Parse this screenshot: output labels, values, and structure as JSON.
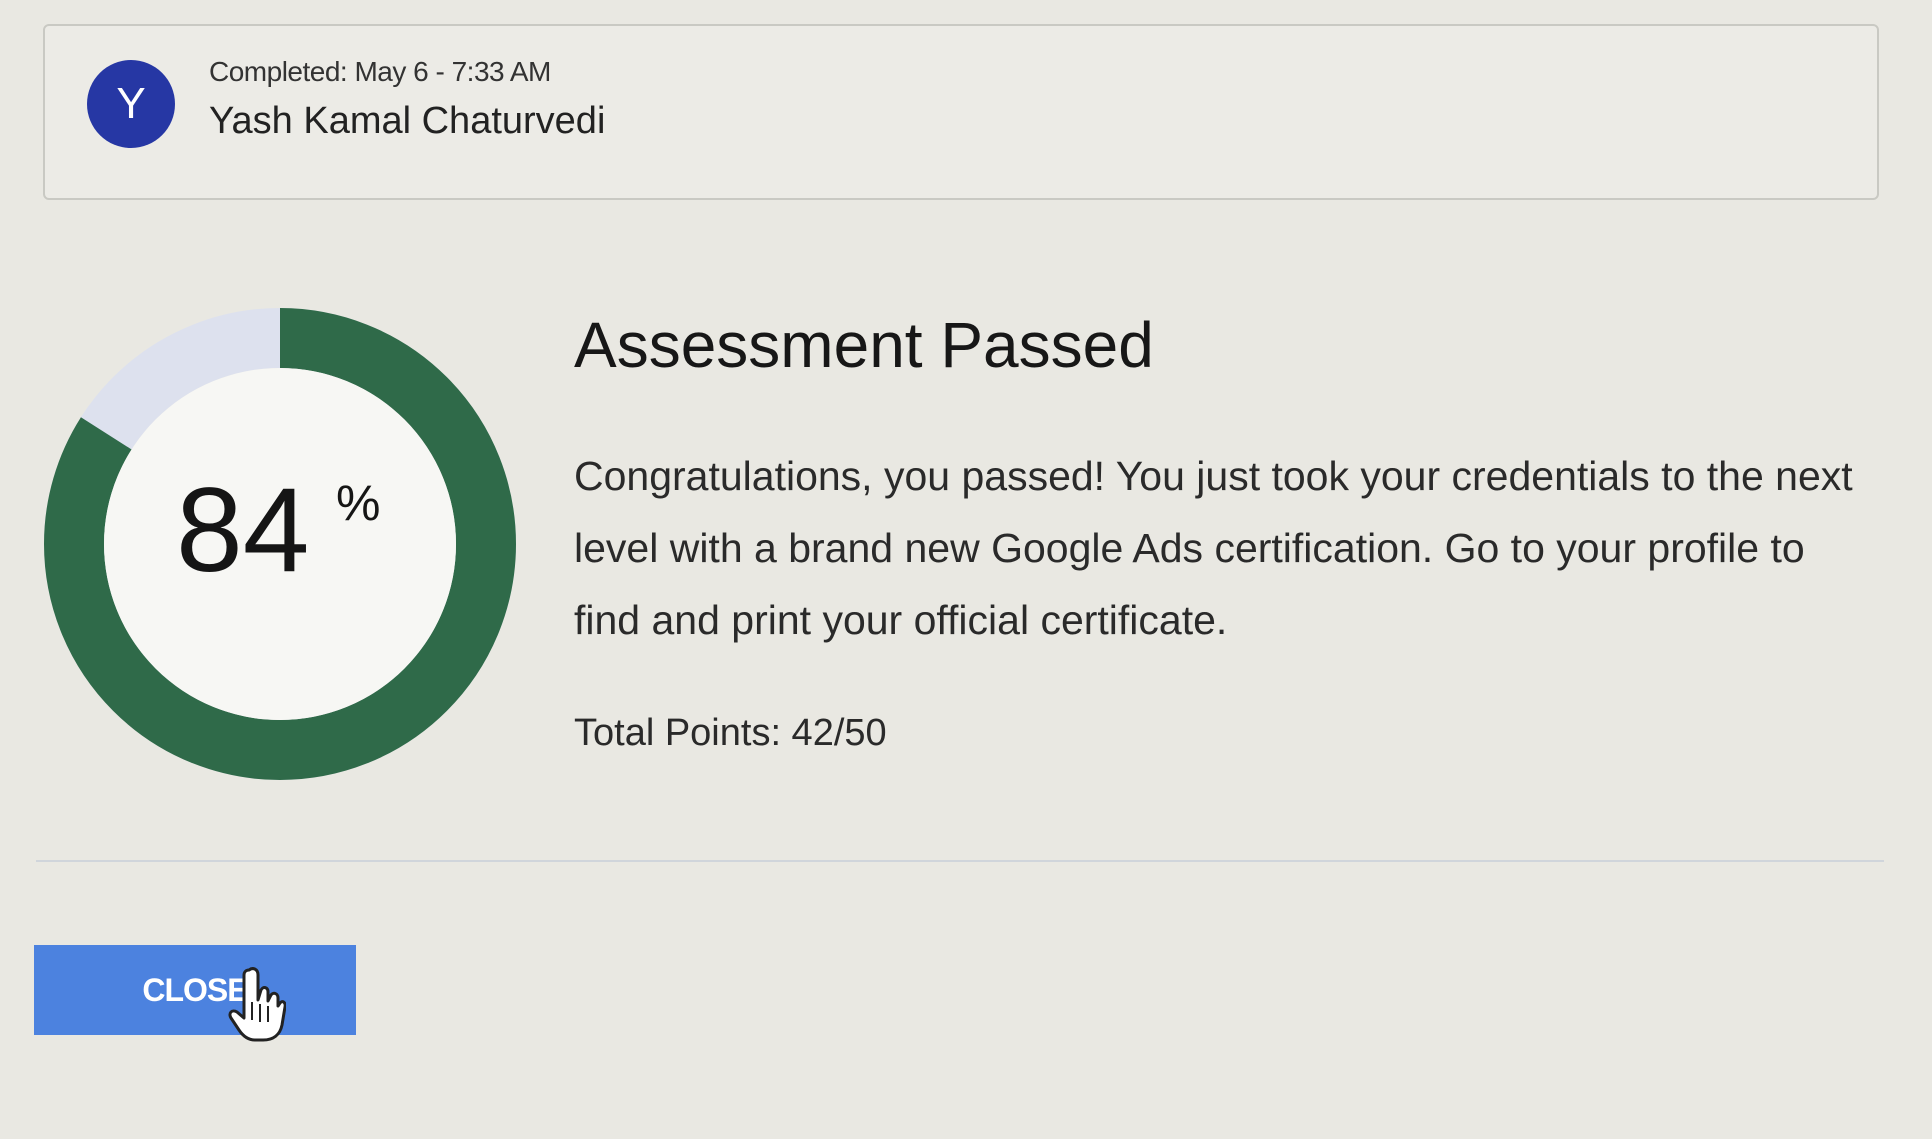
{
  "user": {
    "avatar_initial": "Y",
    "completed_text": "Completed: May 6 - 7:33 AM",
    "name": "Yash Kamal Chaturvedi"
  },
  "score": {
    "percent": 84,
    "value_text": "84",
    "unit": "%",
    "filled_color": "#2f6a49",
    "remaining_color": "#dde1ee"
  },
  "result": {
    "title": "Assessment Passed",
    "message": "Congratulations, you passed! You just took your credentials to the next level with a brand new Google Ads certification. Go to your profile to find and print your official certificate.",
    "total_points": "Total Points: 42/50"
  },
  "actions": {
    "close_label": "CLOSE"
  },
  "icons": {
    "avatar": "avatar",
    "pointer": "hand-pointer-icon"
  }
}
